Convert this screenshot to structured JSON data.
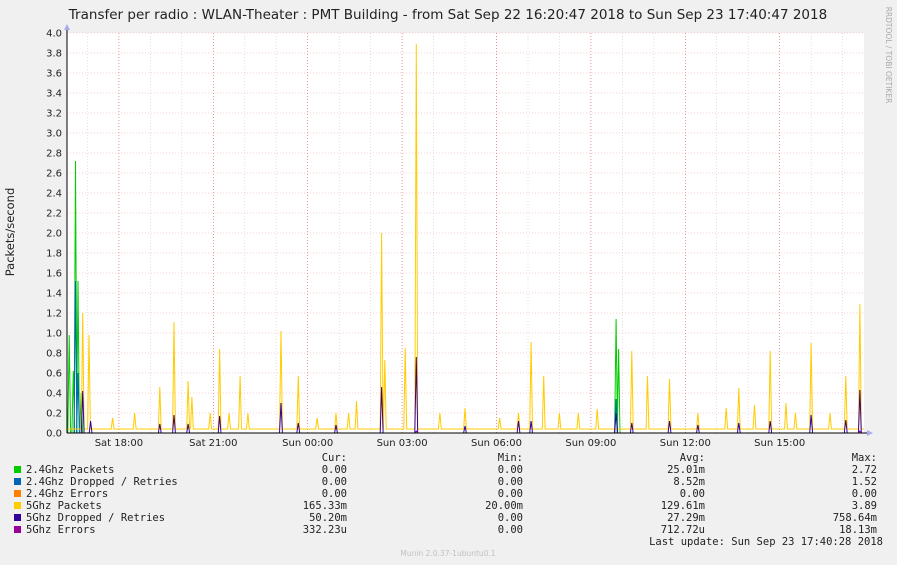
{
  "chart_data": {
    "type": "line",
    "title": "Transfer per radio : WLAN-Theater : PMT Building - from Sat Sep 22 16:20:47 2018 to Sun Sep 23 17:40:47 2018",
    "ylabel": "Packets/second",
    "watermark": "RRDTOOL / TOBI OETIKER",
    "footer": "Munin 2.0.37-1ubuntu0.1",
    "last_update": "Last update:  Sun Sep 23 17:40:28 2018",
    "x_start_hours": 16.35,
    "x_end_hours": 41.68,
    "ylim": [
      0,
      4.0
    ],
    "yticks": [
      0.0,
      0.2,
      0.4,
      0.6,
      0.8,
      1.0,
      1.2,
      1.4,
      1.6,
      1.8,
      2.0,
      2.2,
      2.4,
      2.6,
      2.8,
      3.0,
      3.2,
      3.4,
      3.6,
      3.8,
      4.0
    ],
    "xticks": [
      {
        "at": 18,
        "label": "Sat 18:00"
      },
      {
        "at": 21,
        "label": "Sat 21:00"
      },
      {
        "at": 24,
        "label": "Sun 00:00"
      },
      {
        "at": 27,
        "label": "Sun 03:00"
      },
      {
        "at": 30,
        "label": "Sun 06:00"
      },
      {
        "at": 33,
        "label": "Sun 09:00"
      },
      {
        "at": 36,
        "label": "Sun 12:00"
      },
      {
        "at": 39,
        "label": "Sun 15:00"
      }
    ],
    "legend_headers": {
      "cur": "Cur:",
      "min": "Min:",
      "avg": "Avg:",
      "max": "Max:"
    },
    "series": [
      {
        "name": "2.4Ghz Packets",
        "color": "#00cc00",
        "cur": "0.00",
        "min": "0.00",
        "avg": "25.01m",
        "max": "2.72",
        "baseline": 0.0,
        "spikes": [
          [
            16.42,
            0.98
          ],
          [
            16.55,
            0.62
          ],
          [
            16.62,
            2.72
          ],
          [
            16.7,
            1.52
          ],
          [
            16.8,
            0.4
          ],
          [
            33.8,
            1.14
          ],
          [
            33.88,
            0.84
          ]
        ]
      },
      {
        "name": "2.4Ghz Dropped / Retries",
        "color": "#0066b3",
        "cur": "0.00",
        "min": "0.00",
        "avg": "8.52m",
        "max": "1.52",
        "baseline": 0.0,
        "spikes": [
          [
            16.62,
            1.52
          ],
          [
            16.7,
            0.6
          ],
          [
            33.8,
            0.34
          ]
        ]
      },
      {
        "name": "2.4Ghz Errors",
        "color": "#ff8000",
        "cur": "0.00",
        "min": "0.00",
        "avg": "0.00",
        "max": "0.00",
        "baseline": 0.0,
        "spikes": []
      },
      {
        "name": "5Ghz Packets",
        "color": "#ffcc00",
        "cur": "165.33m",
        "min": "20.00m",
        "avg": "129.61m",
        "max": "3.89",
        "baseline": 0.04,
        "spikes": [
          [
            16.85,
            1.2
          ],
          [
            17.05,
            0.98
          ],
          [
            17.8,
            0.15
          ],
          [
            18.5,
            0.2
          ],
          [
            19.3,
            0.46
          ],
          [
            19.75,
            1.11
          ],
          [
            20.2,
            0.52
          ],
          [
            20.32,
            0.36
          ],
          [
            20.9,
            0.2
          ],
          [
            21.2,
            0.84
          ],
          [
            21.5,
            0.2
          ],
          [
            21.85,
            0.57
          ],
          [
            22.1,
            0.2
          ],
          [
            23.15,
            1.02
          ],
          [
            23.7,
            0.57
          ],
          [
            24.3,
            0.15
          ],
          [
            24.9,
            0.2
          ],
          [
            25.3,
            0.2
          ],
          [
            25.55,
            0.32
          ],
          [
            26.35,
            2.0
          ],
          [
            26.45,
            0.73
          ],
          [
            27.1,
            0.85
          ],
          [
            27.45,
            3.89
          ],
          [
            28.2,
            0.2
          ],
          [
            29.0,
            0.25
          ],
          [
            30.1,
            0.15
          ],
          [
            30.7,
            0.2
          ],
          [
            31.1,
            0.91
          ],
          [
            31.5,
            0.57
          ],
          [
            32.0,
            0.2
          ],
          [
            32.6,
            0.2
          ],
          [
            33.2,
            0.24
          ],
          [
            34.3,
            0.82
          ],
          [
            34.8,
            0.57
          ],
          [
            35.5,
            0.54
          ],
          [
            36.4,
            0.2
          ],
          [
            37.3,
            0.25
          ],
          [
            37.7,
            0.45
          ],
          [
            38.2,
            0.28
          ],
          [
            38.7,
            0.82
          ],
          [
            39.2,
            0.3
          ],
          [
            39.5,
            0.2
          ],
          [
            40.0,
            0.9
          ],
          [
            40.6,
            0.2
          ],
          [
            41.1,
            0.57
          ],
          [
            41.55,
            1.29
          ]
        ]
      },
      {
        "name": "5Ghz Dropped / Retries",
        "color": "#330099",
        "cur": "50.20m",
        "min": "0.00",
        "avg": "27.29m",
        "max": "758.64m",
        "baseline": 0.0,
        "spikes": [
          [
            16.85,
            0.42
          ],
          [
            17.1,
            0.12
          ],
          [
            19.3,
            0.09
          ],
          [
            19.75,
            0.18
          ],
          [
            20.2,
            0.09
          ],
          [
            21.2,
            0.17
          ],
          [
            23.15,
            0.3
          ],
          [
            23.7,
            0.1
          ],
          [
            24.9,
            0.08
          ],
          [
            26.35,
            0.46
          ],
          [
            27.45,
            0.76
          ],
          [
            29.0,
            0.07
          ],
          [
            30.7,
            0.12
          ],
          [
            31.1,
            0.12
          ],
          [
            33.8,
            0.2
          ],
          [
            34.3,
            0.1
          ],
          [
            35.5,
            0.12
          ],
          [
            36.4,
            0.08
          ],
          [
            37.7,
            0.1
          ],
          [
            38.7,
            0.12
          ],
          [
            40.0,
            0.18
          ],
          [
            41.1,
            0.13
          ],
          [
            41.55,
            0.43
          ]
        ]
      },
      {
        "name": "5Ghz Errors",
        "color": "#990099",
        "cur": "332.23u",
        "min": "0.00",
        "avg": "712.72u",
        "max": "18.13m",
        "baseline": 0.0,
        "spikes": [
          [
            27.45,
            0.02
          ],
          [
            41.55,
            0.02
          ]
        ]
      }
    ]
  }
}
